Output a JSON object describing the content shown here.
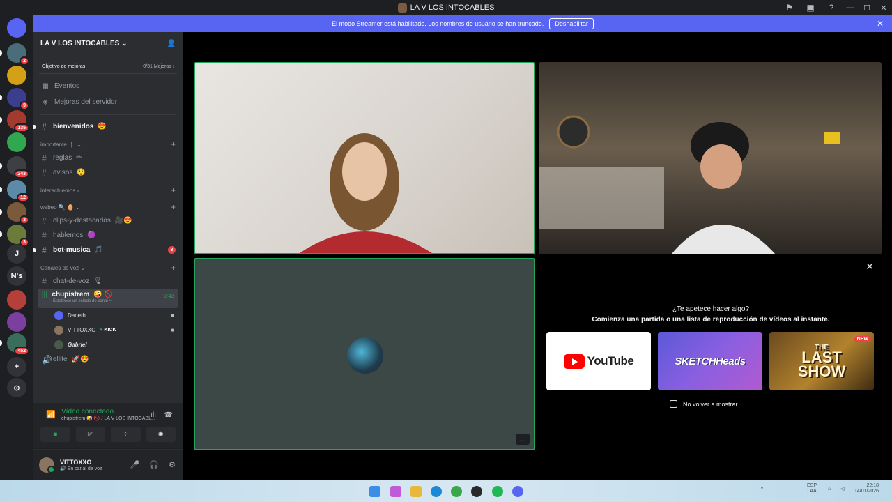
{
  "window": {
    "title": "LA V LOS INTOCABLES"
  },
  "guilds": [
    {
      "label": "",
      "badge": "",
      "color": "#5865f2"
    },
    {
      "label": "",
      "badge": "2",
      "color": "#4a6d7a"
    },
    {
      "label": "",
      "badge": "",
      "color": "#d4a017"
    },
    {
      "label": "",
      "badge": "9",
      "color": "#3b3d8f"
    },
    {
      "label": "",
      "badge": "135",
      "color": "#a33a2f"
    },
    {
      "label": "",
      "badge": "",
      "color": "#2fa84f"
    },
    {
      "label": "",
      "badge": "243",
      "color": "#3d3f45"
    },
    {
      "label": "",
      "badge": "12",
      "color": "#5d8aa8"
    },
    {
      "label": "",
      "badge": "3",
      "color": "#7a5a3a"
    },
    {
      "label": "",
      "badge": "3",
      "color": "#6b7c3a"
    },
    {
      "label": "J",
      "badge": "",
      "color": "#313338"
    },
    {
      "label": "N's",
      "badge": "",
      "color": "#313338"
    },
    {
      "label": "",
      "badge": "",
      "color": "#b5403a"
    },
    {
      "label": "",
      "badge": "",
      "color": "#7b3fa0"
    },
    {
      "label": "",
      "badge": "452",
      "color": "#3a6e5a"
    },
    {
      "label": "+",
      "badge": "",
      "color": "#313338"
    },
    {
      "label": "⊙",
      "badge": "",
      "color": "#313338"
    }
  ],
  "banner": {
    "text": "El modo Streamer está habilitado. Los nombres de usuario se han truncado.",
    "button": "Deshabilitar"
  },
  "server": {
    "name": "LA V LOS INTOCABLES",
    "boost_label": "Objetivo de mejoras",
    "boost_value": "0/31 Mejoras"
  },
  "sidebar_rows": [
    {
      "label": "Eventos"
    },
    {
      "label": "Mejoras del servidor"
    }
  ],
  "channels": {
    "bienvenidos": "bienvenidos",
    "cat_importante": "importante ❗",
    "reglas": "reglas",
    "avisos": "avisos",
    "cat_interactuemos": "interactuemos",
    "cat_webeo": "webeo",
    "clips": "clips-y-destacados",
    "hablemos": "hablemos",
    "bot_musica": "bot-musica",
    "bot_musica_badge": "3",
    "cat_voz": "Canales de voz",
    "chat_de_voz": "chat-de-voz",
    "voice_channel": "chupistrem",
    "voice_timer": "0:43",
    "voice_status": "Establece un estado de canal",
    "ellite": "ellite"
  },
  "voice_users": [
    {
      "name": "Daneth",
      "color": "#5865f2"
    },
    {
      "name": "VITTOXXO",
      "color": "#8a7560"
    },
    {
      "name": "Gabriel",
      "color": "#4a5a4a"
    }
  ],
  "kick_tag": "KICK",
  "voice_panel": {
    "title": "Vídeo conectado",
    "subtitle": "chupistrem 🤪 🚫 / LA V LOS INTOCABL..."
  },
  "user": {
    "name": "VITTOXXO",
    "status": "En canal de voz"
  },
  "activity": {
    "question": "¿Te apetece hacer algo?",
    "prompt": "Comienza una partida o una lista de reproducción de vídeos al instante.",
    "youtube": "YouTube",
    "sketchheads": "SKETCHHeads",
    "lastshow_line1": "THE",
    "lastshow_line2": "LAST",
    "lastshow_line3": "SHOW",
    "new_badge": "NEW",
    "dont_show": "No volver a mostrar"
  },
  "tray": {
    "lang1": "ESP",
    "lang2": "LAA",
    "time": "22:18",
    "date": "14/01/2026"
  }
}
